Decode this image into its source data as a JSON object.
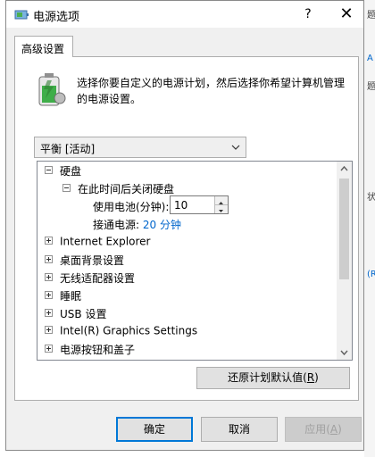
{
  "window": {
    "title": "电源选项",
    "help_glyph": "?",
    "close_glyph": "✕"
  },
  "tab": {
    "label": "高级设置"
  },
  "description": "选择你要自定义的电源计划，然后选择你希望计算机管理的电源设置。",
  "plan_select": {
    "selected": "平衡 [活动]"
  },
  "tree": {
    "hard_disk": "硬盘",
    "turn_off_after": "在此时间后关闭硬盘",
    "on_battery_label": "使用电池(分钟):",
    "on_battery_value": "10",
    "plugged_in_label": "接通电源:",
    "plugged_in_value": "20 分钟",
    "items": [
      "Internet Explorer",
      "桌面背景设置",
      "无线适配器设置",
      "睡眠",
      "USB 设置",
      "Intel(R) Graphics Settings",
      "电源按钮和盖子"
    ]
  },
  "buttons": {
    "restore_prefix": "还原计划默认值(",
    "restore_key": "R",
    "restore_suffix": ")",
    "ok": "确定",
    "cancel": "取消",
    "apply_prefix": "应用(",
    "apply_key": "A",
    "apply_suffix": ")"
  },
  "background_chars": [
    "题",
    "A",
    "题",
    "状",
    "(R"
  ],
  "colors": {
    "accent": "#0078d7",
    "link": "#0066cc"
  }
}
